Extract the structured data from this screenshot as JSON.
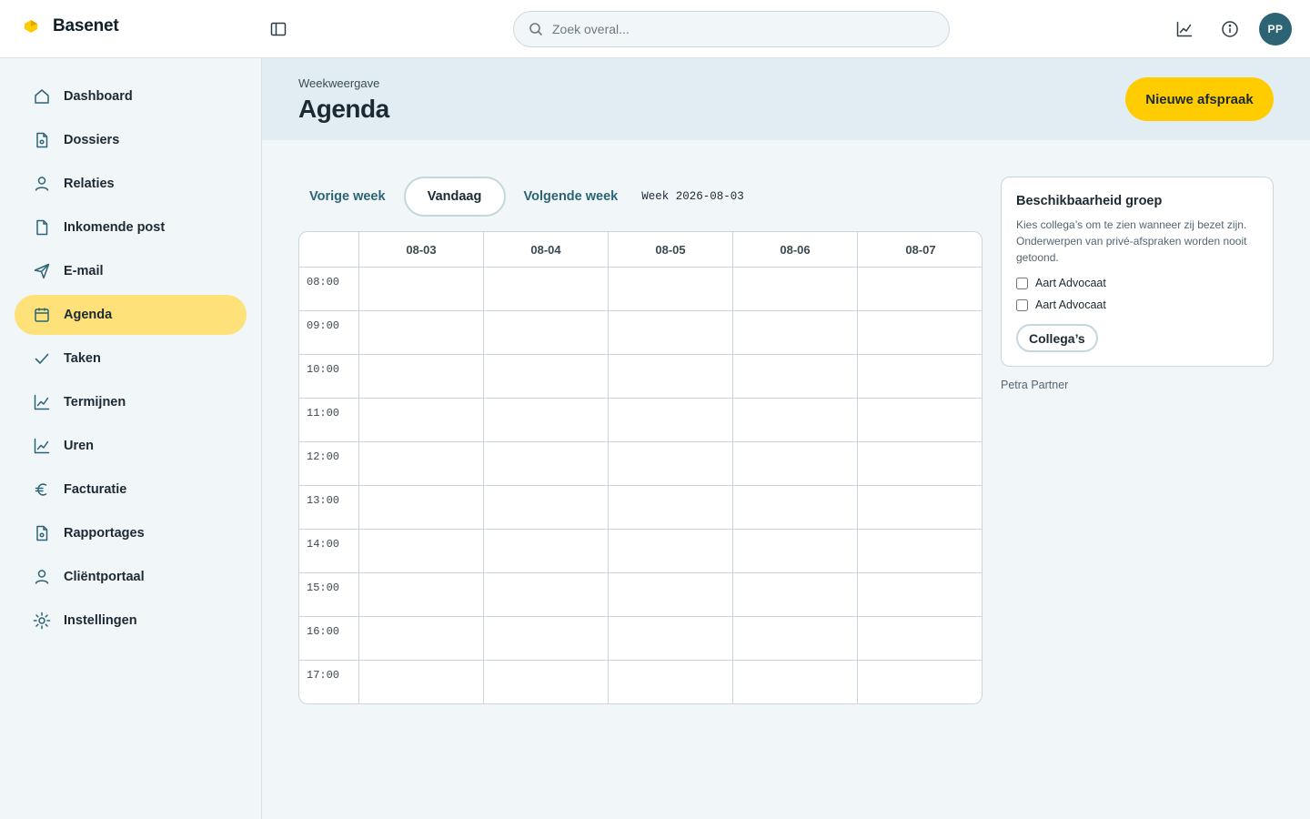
{
  "app": {
    "name": "Basenet",
    "colors": {
      "accent": "#ffcc00",
      "active_nav": "#ffe17a",
      "brand_teal": "#2c6476"
    }
  },
  "topbar": {
    "search_placeholder": "Zoek overal...",
    "icons": [
      "sidebar-toggle-icon",
      "search-icon",
      "chart-icon",
      "info-icon"
    ],
    "avatar_initials": "PP"
  },
  "sidebar": {
    "active": "Agenda",
    "items": [
      {
        "label": "Dashboard",
        "icon": "home-icon"
      },
      {
        "label": "Dossiers",
        "icon": "file-icon"
      },
      {
        "label": "Relaties",
        "icon": "user-icon"
      },
      {
        "label": "Inkomende post",
        "icon": "document-icon"
      },
      {
        "label": "E-mail",
        "icon": "send-icon"
      },
      {
        "label": "Agenda",
        "icon": "calendar-icon"
      },
      {
        "label": "Taken",
        "icon": "check-icon"
      },
      {
        "label": "Termijnen",
        "icon": "chart-icon"
      },
      {
        "label": "Uren",
        "icon": "chart-icon"
      },
      {
        "label": "Facturatie",
        "icon": "euro-icon"
      },
      {
        "label": "Rapportages",
        "icon": "file-icon"
      },
      {
        "label": "Cliëntportaal",
        "icon": "user-icon"
      },
      {
        "label": "Instellingen",
        "icon": "settings-icon"
      }
    ]
  },
  "header": {
    "eyebrow": "Weekweergave",
    "title": "Agenda",
    "new_button": "Nieuwe afspraak"
  },
  "week_nav": {
    "prev": "Vorige week",
    "today": "Vandaag",
    "next": "Volgende week",
    "week_label": "Week 2026-08-03"
  },
  "calendar": {
    "days": [
      "08-03",
      "08-04",
      "08-05",
      "08-06",
      "08-07"
    ],
    "hours": [
      "08:00",
      "09:00",
      "10:00",
      "11:00",
      "12:00",
      "13:00",
      "14:00",
      "15:00",
      "16:00",
      "17:00"
    ]
  },
  "availability": {
    "title": "Beschikbaarheid groep",
    "description": "Kies collega’s om te zien wanneer zij bezet zijn. Onderwerpen van privé-afspraken worden nooit getoond.",
    "colleagues": [
      {
        "name": "Aart Advocaat",
        "checked": false
      },
      {
        "name": "Aart Advocaat",
        "checked": false
      }
    ],
    "button": "Collega’s"
  },
  "current_user": "Petra Partner"
}
